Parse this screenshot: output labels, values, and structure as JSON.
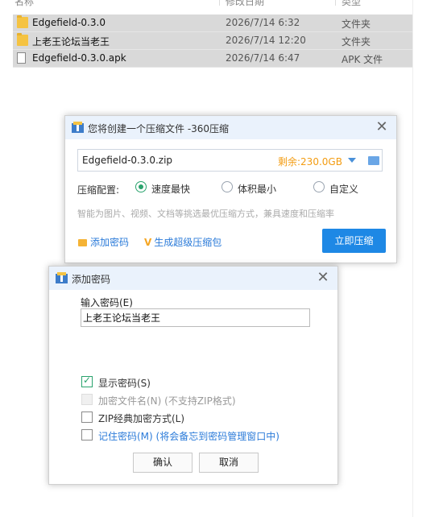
{
  "explorer": {
    "columns": {
      "name": "名称",
      "modified": "修改日期",
      "type": "类型"
    },
    "files": [
      {
        "name": "Edgefield-0.3.0",
        "date": "2026/7/14 6:32",
        "type": "文件夹",
        "icon": "folder-icon"
      },
      {
        "name": "上老王论坛当老王",
        "date": "2026/7/14 12:20",
        "type": "文件夹",
        "icon": "folder-icon"
      },
      {
        "name": "Edgefield-0.3.0.apk",
        "date": "2026/7/14 6:47",
        "type": "APK 文件",
        "icon": "file-icon"
      }
    ]
  },
  "compress_dialog": {
    "title": "您将创建一个压缩文件 -360压缩",
    "path": "Edgefield-0.3.0.zip",
    "remaining": "剩余:230.0GB",
    "config_label": "压缩配置:",
    "options": [
      {
        "label": "速度最快",
        "selected": true
      },
      {
        "label": "体积最小",
        "selected": false
      },
      {
        "label": "自定义",
        "selected": false
      }
    ],
    "hint": "智能为图片、视频、文档等挑选最优压缩方式，兼具速度和压缩率",
    "add_password_link": "添加密码",
    "super_package_link": "生成超级压缩包",
    "compress_button": "立即压缩",
    "accent_color": "#1e88e5",
    "remaining_color": "#f39c12"
  },
  "password_dialog": {
    "title": "添加密码",
    "input_label": "输入密码(E)",
    "password_value": "上老王论坛当老王",
    "show_password": "显示密码(S)",
    "encrypt_filenames": "加密文件名(N) (不支持ZIP格式)",
    "zip_classic": "ZIP经典加密方式(L)",
    "remember_password": "记住密码(M) (将会备忘到密码管理窗口中)",
    "show_password_checked": true,
    "ok_button": "确认",
    "cancel_button": "取消"
  }
}
